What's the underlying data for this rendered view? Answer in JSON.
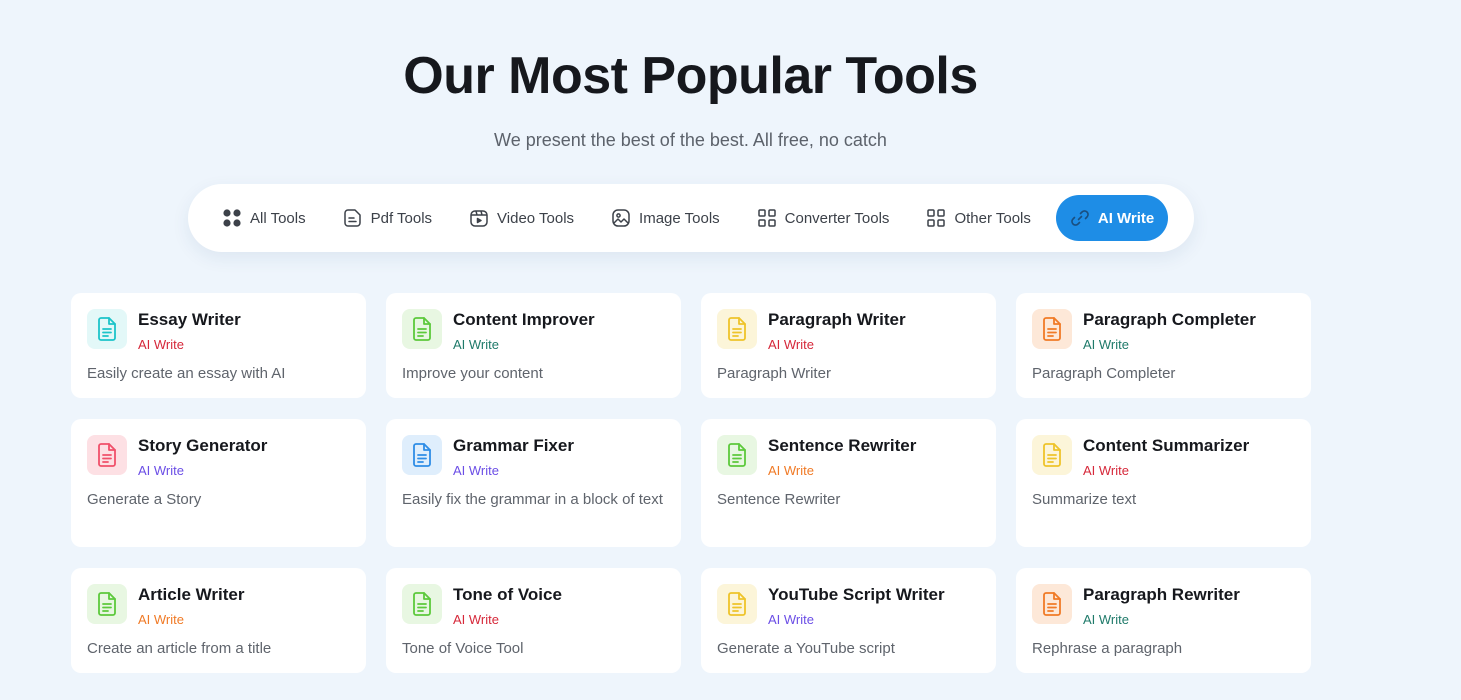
{
  "header": {
    "title": "Our Most Popular Tools",
    "subtitle": "We present the best of the best. All free, no catch"
  },
  "tabs": [
    {
      "label": "All Tools",
      "icon": "grid-dots-icon",
      "active": false
    },
    {
      "label": "Pdf Tools",
      "icon": "pdf-file-icon",
      "active": false
    },
    {
      "label": "Video Tools",
      "icon": "video-icon",
      "active": false
    },
    {
      "label": "Image Tools",
      "icon": "image-icon",
      "active": false
    },
    {
      "label": "Converter Tools",
      "icon": "grid-squares-icon",
      "active": false
    },
    {
      "label": "Other Tools",
      "icon": "grid-squares-icon",
      "active": false
    },
    {
      "label": "AI Write",
      "icon": "link-icon",
      "active": true
    }
  ],
  "colors": {
    "accent": "#1e8de6",
    "background": "#eef5fc"
  },
  "cards": [
    {
      "title": "Essay Writer",
      "category": "AI Write",
      "category_color": "#d6283a",
      "description": "Easily create an essay with AI",
      "icon_color": "#1cc4c9",
      "icon_bg": "#e3f8f8"
    },
    {
      "title": "Content Improver",
      "category": "AI Write",
      "category_color": "#1f7a6a",
      "description": "Improve your content",
      "icon_color": "#5cc93c",
      "icon_bg": "#e8f7e2"
    },
    {
      "title": "Paragraph Writer",
      "category": "AI Write",
      "category_color": "#d6283a",
      "description": "Paragraph Writer",
      "icon_color": "#eec42a",
      "icon_bg": "#fcf5d9"
    },
    {
      "title": "Paragraph Completer",
      "category": "AI Write",
      "category_color": "#1f7a6a",
      "description": "Paragraph Completer",
      "icon_color": "#f07a26",
      "icon_bg": "#fde8d8"
    },
    {
      "title": "Story Generator",
      "category": "AI Write",
      "category_color": "#6b4ee6",
      "description": "Generate a Story",
      "icon_color": "#f0506a",
      "icon_bg": "#fde0e4"
    },
    {
      "title": "Grammar Fixer",
      "category": "AI Write",
      "category_color": "#6b4ee6",
      "description": "Easily fix the grammar in a block of text",
      "icon_color": "#2e8de6",
      "icon_bg": "#dfeefc"
    },
    {
      "title": "Sentence Rewriter",
      "category": "AI Write",
      "category_color": "#f07a26",
      "description": "Sentence Rewriter",
      "icon_color": "#5cc93c",
      "icon_bg": "#e8f7e2"
    },
    {
      "title": "Content Summarizer",
      "category": "AI Write",
      "category_color": "#d6283a",
      "description": "Summarize text",
      "icon_color": "#eec42a",
      "icon_bg": "#fcf5d9"
    },
    {
      "title": "Article Writer",
      "category": "AI Write",
      "category_color": "#f07a26",
      "description": "Create an article from a title",
      "icon_color": "#5cc93c",
      "icon_bg": "#e8f7e2"
    },
    {
      "title": "Tone of Voice",
      "category": "AI Write",
      "category_color": "#d6283a",
      "description": "Tone of Voice Tool",
      "icon_color": "#5cc93c",
      "icon_bg": "#e8f7e2"
    },
    {
      "title": "YouTube Script Writer",
      "category": "AI Write",
      "category_color": "#6b4ee6",
      "description": "Generate a YouTube script",
      "icon_color": "#eec42a",
      "icon_bg": "#fcf5d9"
    },
    {
      "title": "Paragraph Rewriter",
      "category": "AI Write",
      "category_color": "#1f7a6a",
      "description": "Rephrase a paragraph",
      "icon_color": "#f07a26",
      "icon_bg": "#fde8d8"
    }
  ]
}
